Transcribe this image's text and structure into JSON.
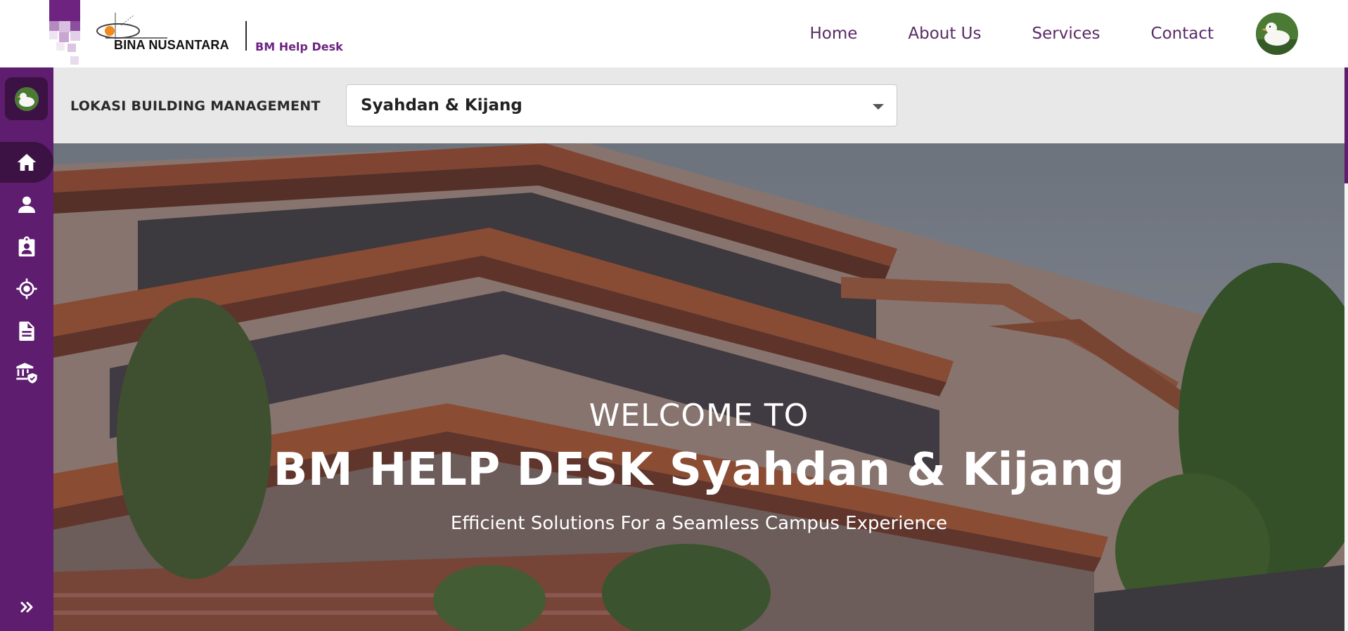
{
  "header": {
    "logo": {
      "wordmark": "BINA NUSANTARA",
      "product": "BM Help Desk"
    },
    "nav": [
      {
        "label": "Home"
      },
      {
        "label": "About Us"
      },
      {
        "label": "Services"
      },
      {
        "label": "Contact"
      }
    ],
    "avatar_icon": "duck-avatar"
  },
  "sidebar": {
    "avatar_icon": "duck-avatar",
    "items": [
      {
        "icon": "home-icon",
        "active": true
      },
      {
        "icon": "user-icon",
        "active": false
      },
      {
        "icon": "clipboard-user-icon",
        "active": false
      },
      {
        "icon": "location-target-icon",
        "active": false
      },
      {
        "icon": "document-icon",
        "active": false
      },
      {
        "icon": "building-shield-icon",
        "active": false
      }
    ],
    "expand_icon": "double-chevron-right-icon"
  },
  "location": {
    "label": "LOKASI BUILDING MANAGEMENT",
    "selected": "Syahdan & Kijang"
  },
  "hero": {
    "pretitle": "WELCOME TO",
    "title": "BM HELP DESK Syahdan & Kijang",
    "subtitle": "Efficient Solutions For a Seamless Campus Experience"
  },
  "colors": {
    "brand_purple": "#5e1d6e",
    "brand_purple_dark": "#3b1243",
    "nav_text": "#5a2a66",
    "product_text": "#6e2381",
    "location_bar_bg": "#e8e8e8"
  }
}
